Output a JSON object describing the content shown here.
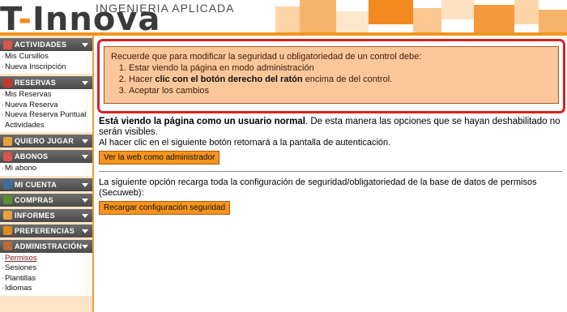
{
  "header": {
    "logo_main": "T-Innova",
    "logo_sub": "INGENIERIA APLICADA"
  },
  "sidebar": {
    "sections": [
      {
        "title": "ACTIVIDADES",
        "icon": "calendar-icon",
        "icon_color": "#d9534f",
        "items": [
          "Mis Cursillos",
          "Nueva Inscripción"
        ]
      },
      {
        "title": "RESERVAS",
        "icon": "grid-icon",
        "icon_color": "#c0392b",
        "items": [
          "Mis Reservas",
          "Nueva Reserva",
          "Nueva Reserva Puntual Actividades"
        ]
      },
      {
        "title": "QUIERO JUGAR",
        "icon": "people-icon",
        "icon_color": "#e6a23c",
        "items": []
      },
      {
        "title": "ABONOS",
        "icon": "ticket-icon",
        "icon_color": "#d9534f",
        "items": [
          "Mi abono"
        ]
      },
      {
        "title": "MI CUENTA",
        "icon": "user-icon",
        "icon_color": "#3b6ea5",
        "items": []
      },
      {
        "title": "COMPRAS",
        "icon": "cart-icon",
        "icon_color": "#5a8f2f",
        "items": []
      },
      {
        "title": "INFORMES",
        "icon": "chart-icon",
        "icon_color": "#e6a23c",
        "items": []
      },
      {
        "title": "PREFERENCIAS",
        "icon": "tools-icon",
        "icon_color": "#e08b1e",
        "items": []
      },
      {
        "title": "ADMINISTRACIÓN",
        "icon": "admin-icon",
        "icon_color": "#b86a3a",
        "items": [
          "Permisos",
          "Sesiones",
          "Plantillas",
          "Idiomas"
        ],
        "active_item": "Permisos"
      }
    ]
  },
  "notice": {
    "intro": "Recuerde que para modificar la seguridad u obligatoriedad de un control debe:",
    "step1": "Estar viendo la página en modo administración",
    "step2_pre": "Hacer ",
    "step2_bold": "clic con el botón derecho del ratón",
    "step2_post": " encima de del control.",
    "step3": "Aceptar los cambios"
  },
  "section1": {
    "bold": "Está viendo la página como un usuario normal",
    "text": ". De esta manera las opciones que se hayan deshabilitado no serán visibles.",
    "text2": "Al hacer clic en el siguiente botón retornará a la pantalla de autenticación.",
    "button": "Ver la web como administrador"
  },
  "section2": {
    "text": "La siguiente opción recarga toda la configuración de seguridad/obligatoriedad de la base de datos de permisos (Secuweb):",
    "button": "Recargar configuración seguridad"
  },
  "colors": {
    "accent": "#f7941d",
    "notice_bg": "#fbc79a",
    "highlight_border": "#d8231f",
    "sidebar_header": "#555555"
  }
}
